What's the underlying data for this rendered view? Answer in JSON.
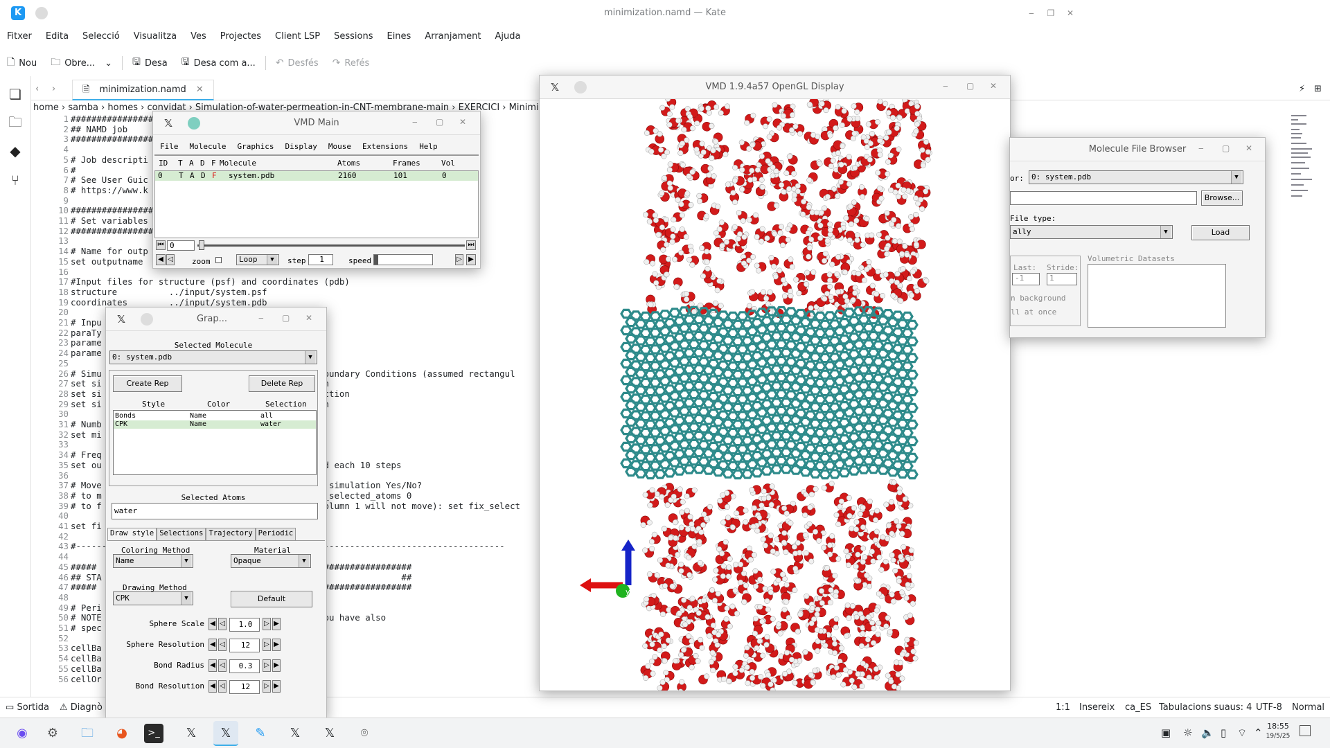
{
  "kate": {
    "title": "minimization.namd — Kate",
    "menu": [
      "Fitxer",
      "Edita",
      "Selecció",
      "Visualitza",
      "Ves",
      "Projectes",
      "Client LSP",
      "Sessions",
      "Eines",
      "Arranjament",
      "Ajuda"
    ],
    "toolbar": {
      "new": "Nou",
      "open": "Obre...",
      "save": "Desa",
      "save_as": "Desa com a...",
      "undo": "Desfés",
      "redo": "Refés"
    },
    "tab": "minimization.namd",
    "breadcrumb": "home › samba › homes › convidat › Simulation-of-water-permeation-in-CNT-membrane-main › EXERCICI › Minimiza",
    "code_lines": [
      "##########################",
      "## NAMD job",
      "##########################",
      "",
      "# Job descripti",
      "#",
      "# See User Guic",
      "# https://www.k",
      "",
      "##########################",
      "# Set variables",
      "##########################",
      "",
      "# Name for outp",
      "set outputname",
      "",
      "#Input files for structure (psf) and coordinates (pdb)",
      "structure          ../input/system.psf",
      "coordinates        ../input/system.pdb",
      "",
      "# Inpu",
      "paraTy",
      "parame                                          p",
      "parame",
      "",
      "# Simu                                          Boundary Conditions (assumed rectangul",
      "set si                                          on",
      "set si                                          ection",
      "set si                                          on",
      "",
      "# Numb",
      "set mi",
      "",
      "# Freq",
      "set ou                                          ed each 10 steps",
      "",
      "# Move                                          e simulation Yes/No?",
      "# to m                                          x_selected_atoms 0",
      "# to f                                          column 1 will not move): set fix_select",
      "",
      "set fi",
      "",
      "#-----------------------------------------------------------------------------------",
      "",
      "#####                                           ##################",
      "## STA                                                          ##",
      "#####                                           ##################",
      "",
      "# Peri",
      "# NOTE                                          you have also",
      "# spec",
      "",
      "cellBa",
      "cellBa",
      "cellBa",
      "cellOr"
    ],
    "status": {
      "output": "Sortida",
      "diagnostics": "Diagnò",
      "pos": "1:1",
      "mode": "Insereix",
      "lang": "ca_ES",
      "tabs": "Tabulacions suaus: 4",
      "enc": "UTF-8",
      "hl": "Normal"
    }
  },
  "vmd_main": {
    "title": "VMD Main",
    "menu": [
      "File",
      "Molecule",
      "Graphics",
      "Display",
      "Mouse",
      "Extensions",
      "Help"
    ],
    "headers": [
      "ID",
      "T",
      "A",
      "D",
      "F",
      "Molecule",
      "Atoms",
      "Frames",
      "Vol"
    ],
    "row": {
      "id": "0",
      "t": "T",
      "a": "A",
      "d": "D",
      "f": "F",
      "molecule": "system.pdb",
      "atoms": "2160",
      "frames": "101",
      "vol": "0"
    },
    "frame": "0",
    "zoom": "zoom",
    "loop": "Loop",
    "step_label": "step",
    "step": "1",
    "speed": "speed"
  },
  "graphics": {
    "title": "Grap...",
    "selected_molecule_label": "Selected Molecule",
    "selected_molecule": "0: system.pdb",
    "create_rep": "Create Rep",
    "delete_rep": "Delete Rep",
    "rep_headers": {
      "style": "Style",
      "color": "Color",
      "selection": "Selection"
    },
    "reps": [
      {
        "style": "Bonds",
        "color": "Name",
        "selection": "all"
      },
      {
        "style": "CPK",
        "color": "Name",
        "selection": "water"
      }
    ],
    "selected_atoms_label": "Selected Atoms",
    "selected_atoms": "water",
    "tabs": [
      "Draw style",
      "Selections",
      "Trajectory",
      "Periodic"
    ],
    "coloring_label": "Coloring Method",
    "coloring": "Name",
    "material_label": "Material",
    "material": "Opaque",
    "drawing_label": "Drawing Method",
    "drawing": "CPK",
    "default": "Default",
    "params": [
      {
        "label": "Sphere Scale",
        "value": "1.0"
      },
      {
        "label": "Sphere Resolution",
        "value": "12"
      },
      {
        "label": "Bond Radius",
        "value": "0.3"
      },
      {
        "label": "Bond Resolution",
        "value": "12"
      }
    ]
  },
  "display": {
    "title": "VMD 1.9.4a57 OpenGL Display",
    "axis_y": "y"
  },
  "browser": {
    "title": "Molecule File Browser",
    "for_label": "or:",
    "for_value": "0: system.pdb",
    "browse": "Browse...",
    "filetype_label": "File type:",
    "filetype": "ally",
    "load": "Load",
    "last_label": "Last:",
    "last": "-1",
    "stride_label": "Stride:",
    "stride": "1",
    "background": "n background",
    "all_at_once": "ll at once",
    "volumetric": "Volumetric Datasets"
  },
  "clock": {
    "time": "18:55",
    "date": "19/5/25"
  },
  "colors": {
    "accent": "#3daee9",
    "carbon": "#2e8b8b",
    "oxygen": "#d21a1a",
    "hydrogen": "#f0f0f0",
    "selected_row": "#d6ecd2"
  }
}
